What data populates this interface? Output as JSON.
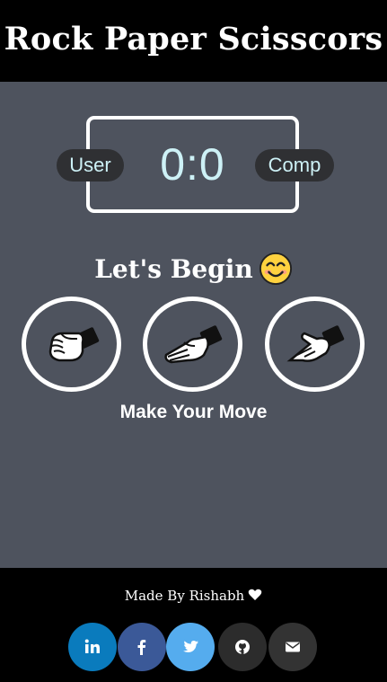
{
  "header": {
    "title": "Rock Paper Scisscors"
  },
  "scoreboard": {
    "user_label": "User",
    "comp_label": "Comp",
    "score": "0:0"
  },
  "message": {
    "text": "Let's Begin",
    "emoji": "smiling-face-icon"
  },
  "choices": [
    {
      "name": "rock",
      "icon": "rock-hand-icon"
    },
    {
      "name": "paper",
      "icon": "paper-hand-icon"
    },
    {
      "name": "scissors",
      "icon": "scissors-hand-icon"
    }
  ],
  "prompt": {
    "text": "Make Your Move"
  },
  "footer": {
    "credit": "Made By Rishabh",
    "heart_icon": "heart-icon",
    "social": [
      {
        "name": "linkedin",
        "icon": "linkedin-icon",
        "color": "#0a7bbd"
      },
      {
        "name": "facebook",
        "icon": "facebook-icon",
        "color": "#3b5998"
      },
      {
        "name": "twitter",
        "icon": "twitter-icon",
        "color": "#55acee"
      },
      {
        "name": "github",
        "icon": "github-icon",
        "color": "#2c2c2c"
      },
      {
        "name": "email",
        "icon": "envelope-icon",
        "color": "#333333"
      }
    ]
  },
  "colors": {
    "main_background": "#4e535e",
    "score_text": "#cdf1f6",
    "badge_background": "#2f3033"
  }
}
